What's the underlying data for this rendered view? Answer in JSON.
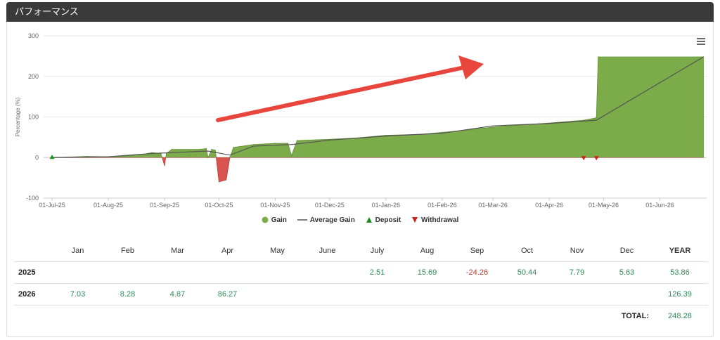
{
  "header": {
    "title": "パフォーマンス"
  },
  "chart_data": {
    "type": "area",
    "ylabel": "Percentage (%)",
    "ylim": [
      -100,
      300
    ],
    "y_ticks": [
      300,
      200,
      100,
      0,
      -100
    ],
    "x_ticks": [
      "01-Jul-25",
      "01-Aug-25",
      "01-Sep-25",
      "01-Oct-25",
      "01-Nov-25",
      "01-Dec-25",
      "01-Jan-26",
      "01-Feb-26",
      "01-Mar-26",
      "01-Apr-26",
      "01-May-26",
      "01-Jun-26"
    ],
    "grid": true,
    "legend_position": "bottom-center",
    "series": [
      {
        "name": "Gain",
        "color": "#7cab4a",
        "negative_color": "#d9534f",
        "points": [
          [
            "2025-07-01",
            0
          ],
          [
            "2025-07-10",
            1
          ],
          [
            "2025-07-20",
            3
          ],
          [
            "2025-08-01",
            2
          ],
          [
            "2025-08-12",
            4
          ],
          [
            "2025-08-20",
            8
          ],
          [
            "2025-08-25",
            12
          ],
          [
            "2025-08-30",
            10
          ],
          [
            "2025-09-01",
            -20
          ],
          [
            "2025-09-02",
            10
          ],
          [
            "2025-09-05",
            20
          ],
          [
            "2025-09-20",
            20
          ],
          [
            "2025-09-24",
            22
          ],
          [
            "2025-09-25",
            0
          ],
          [
            "2025-09-27",
            20
          ],
          [
            "2025-09-29",
            18
          ],
          [
            "2025-10-01",
            -60
          ],
          [
            "2025-10-05",
            -55
          ],
          [
            "2025-10-07",
            0
          ],
          [
            "2025-10-09",
            25
          ],
          [
            "2025-10-20",
            32
          ],
          [
            "2025-11-01",
            35
          ],
          [
            "2025-11-08",
            35
          ],
          [
            "2025-11-10",
            5
          ],
          [
            "2025-11-13",
            42
          ],
          [
            "2025-12-01",
            45
          ],
          [
            "2025-12-15",
            48
          ],
          [
            "2026-01-01",
            55
          ],
          [
            "2026-01-20",
            57
          ],
          [
            "2026-02-01",
            62
          ],
          [
            "2026-02-15",
            68
          ],
          [
            "2026-03-01",
            75
          ],
          [
            "2026-03-15",
            80
          ],
          [
            "2026-04-01",
            85
          ],
          [
            "2026-04-20",
            92
          ],
          [
            "2026-04-27",
            98
          ],
          [
            "2026-04-28",
            248
          ],
          [
            "2026-06-25",
            248
          ]
        ]
      },
      {
        "name": "Average Gain",
        "color": "#555555",
        "points": [
          [
            "2025-07-01",
            0
          ],
          [
            "2025-08-01",
            2
          ],
          [
            "2025-08-25",
            10
          ],
          [
            "2025-09-25",
            16
          ],
          [
            "2025-10-07",
            6
          ],
          [
            "2025-10-20",
            28
          ],
          [
            "2025-11-10",
            32
          ],
          [
            "2025-12-01",
            43
          ],
          [
            "2026-01-01",
            53
          ],
          [
            "2026-02-01",
            60
          ],
          [
            "2026-03-01",
            78
          ],
          [
            "2026-04-01",
            84
          ],
          [
            "2026-04-27",
            92
          ],
          [
            "2026-06-25",
            248
          ]
        ]
      },
      {
        "name": "Deposit",
        "color": "#1a8f1a",
        "points": [
          [
            "2025-07-01",
            0
          ]
        ]
      },
      {
        "name": "Withdrawal",
        "color": "#cc2222",
        "points": [
          [
            "2026-04-20",
            0
          ],
          [
            "2026-04-27",
            0
          ]
        ]
      }
    ]
  },
  "legend": {
    "gain": "Gain",
    "avg": "Average Gain",
    "deposit": "Deposit",
    "withdrawal": "Withdrawal"
  },
  "table": {
    "months": [
      "Jan",
      "Feb",
      "Mar",
      "Apr",
      "May",
      "June",
      "July",
      "Aug",
      "Sep",
      "Oct",
      "Nov",
      "Dec"
    ],
    "year_header": "YEAR",
    "rows": [
      {
        "year": "2025",
        "values": [
          "",
          "",
          "",
          "",
          "",
          "",
          "2.51",
          "15.69",
          "-24.26",
          "50.44",
          "7.79",
          "5.63"
        ],
        "total": "53.86"
      },
      {
        "year": "2026",
        "values": [
          "7.03",
          "8.28",
          "4.87",
          "86.27",
          "",
          "",
          "",
          "",
          "",
          "",
          "",
          ""
        ],
        "total": "126.39"
      }
    ],
    "total_label": "TOTAL:",
    "total_value": "248.28"
  }
}
